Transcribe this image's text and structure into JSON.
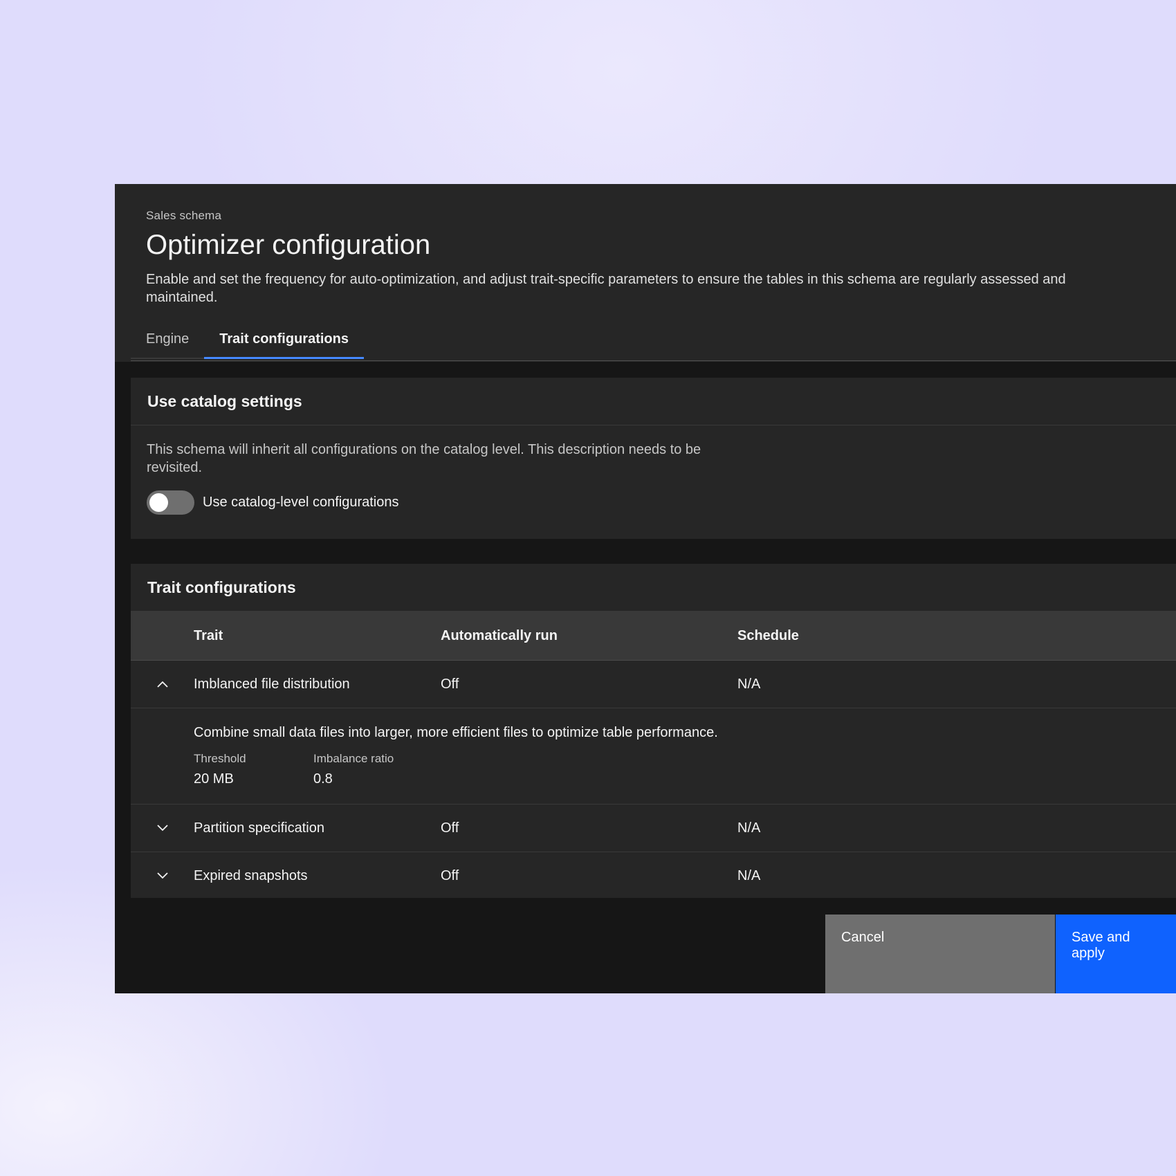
{
  "modal": {
    "eyebrow": "Sales schema",
    "title": "Optimizer configuration",
    "description": "Enable and set the frequency for auto-optimization, and adjust trait-specific parameters to ensure the tables in this schema are regularly assessed and maintained."
  },
  "tabs": [
    {
      "label": "Engine",
      "selected": false
    },
    {
      "label": "Trait configurations",
      "selected": true
    }
  ],
  "catalog_settings": {
    "heading": "Use catalog settings",
    "note": "This schema will inherit all configurations on the catalog level. This description needs to be revisited.",
    "toggle_label": "Use catalog-level configurations",
    "toggle_on": false
  },
  "traits": {
    "heading": "Trait configurations",
    "columns": [
      "Trait",
      "Automatically run",
      "Schedule"
    ],
    "rows": [
      {
        "trait": "Imblanced file distribution",
        "auto_run": "Off",
        "schedule": "N/A",
        "expanded": true
      },
      {
        "trait": "Partition specification",
        "auto_run": "Off",
        "schedule": "N/A",
        "expanded": false
      },
      {
        "trait": "Expired snapshots",
        "auto_run": "Off",
        "schedule": "N/A",
        "expanded": false
      }
    ],
    "expanded_detail": {
      "description": "Combine small data files into larger, more efficient files to optimize table performance.",
      "fields": [
        {
          "label": "Threshold",
          "value": "20 MB"
        },
        {
          "label": "Imbalance ratio",
          "value": "0.8"
        }
      ]
    }
  },
  "footer": {
    "cancel_label": "Cancel",
    "primary_label": "Save and apply"
  },
  "colors": {
    "accent": "#0f62fe",
    "tab_indicator": "#4589ff",
    "panel": "#262626",
    "canvas": "#161616"
  }
}
